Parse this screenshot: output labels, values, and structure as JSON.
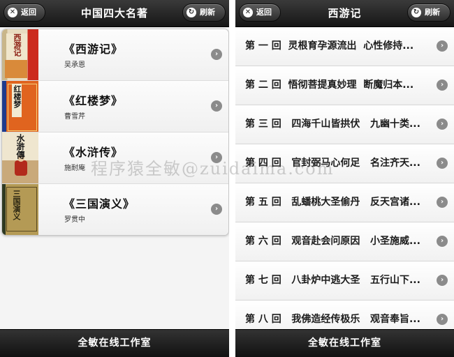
{
  "left": {
    "header": {
      "title": "中国四大名著",
      "back_label": "返回",
      "refresh_label": "刷新"
    },
    "books": [
      {
        "title": "《西游记》",
        "author": "吴承恩",
        "cover_text": "西游记"
      },
      {
        "title": "《红楼梦》",
        "author": "曹雪芹",
        "cover_text": "红楼梦"
      },
      {
        "title": "《水浒传》",
        "author": "施耐庵",
        "cover_text": "水滸傳"
      },
      {
        "title": "《三国演义》",
        "author": "罗贯中",
        "cover_text": "三国演义"
      }
    ],
    "footer": "全敏在线工作室"
  },
  "right": {
    "header": {
      "title": "西游记",
      "back_label": "返回",
      "refresh_label": "刷新"
    },
    "chapters": [
      "第 一 回  灵根育孕源流出  心性修持...",
      "第 二 回  悟彻菩提真妙理  断魔归本...",
      "第 三 回   四海千山皆拱伏   九幽十类...",
      "第 四 回   官封弼马心何足   名注齐天...",
      "第 五 回   乱蟠桃大圣偷丹   反天宫诸...",
      "第 六 回   观音赴会问原因   小圣施威...",
      "第 七 回   八卦炉中逃大圣   五行山下...",
      "第 八 回   我佛造经传极乐   观音奉旨..."
    ],
    "footer": "全敏在线工作室"
  },
  "watermark": "程序猿全敏@zuidaima.com",
  "icons": {
    "back": "close-icon",
    "refresh": "refresh-icon",
    "row_arrow": "chevron-right-icon"
  },
  "colors": {
    "header": "#1f1f1f",
    "footer": "#1a1a1a",
    "list_bg": "#f4f4f4",
    "arrow": "#8b8b8b"
  }
}
